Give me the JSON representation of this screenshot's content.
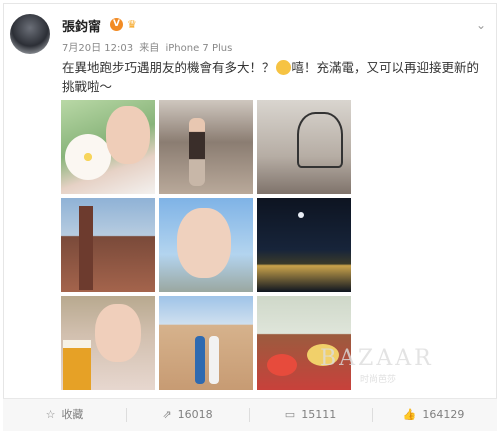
{
  "post": {
    "username": "張鈞甯",
    "verified_badge": "V",
    "date": "7月20日 12:03",
    "source_prefix": "来自",
    "device": "iPhone 7 Plus",
    "text_part1": "在異地跑步巧遇朋友的機會有多大！？",
    "text_part2": "嘻！充滿電，又可以再迎接更新的挑戰啦～",
    "expand_icon": "chevron-down-icon"
  },
  "photos": [
    {
      "label": "photo-1"
    },
    {
      "label": "photo-2"
    },
    {
      "label": "photo-3"
    },
    {
      "label": "photo-4"
    },
    {
      "label": "photo-5"
    },
    {
      "label": "photo-6"
    },
    {
      "label": "photo-7"
    },
    {
      "label": "photo-8"
    },
    {
      "label": "photo-9"
    }
  ],
  "watermark": {
    "brand": "BAZAAR",
    "sub": "时尚芭莎"
  },
  "actions": {
    "favorite_label": "收藏",
    "repost_count": "16018",
    "comment_count": "15111",
    "like_count": "164129"
  },
  "colors": {
    "badge": "#f28b24",
    "text": "#333333",
    "meta": "#888888"
  }
}
